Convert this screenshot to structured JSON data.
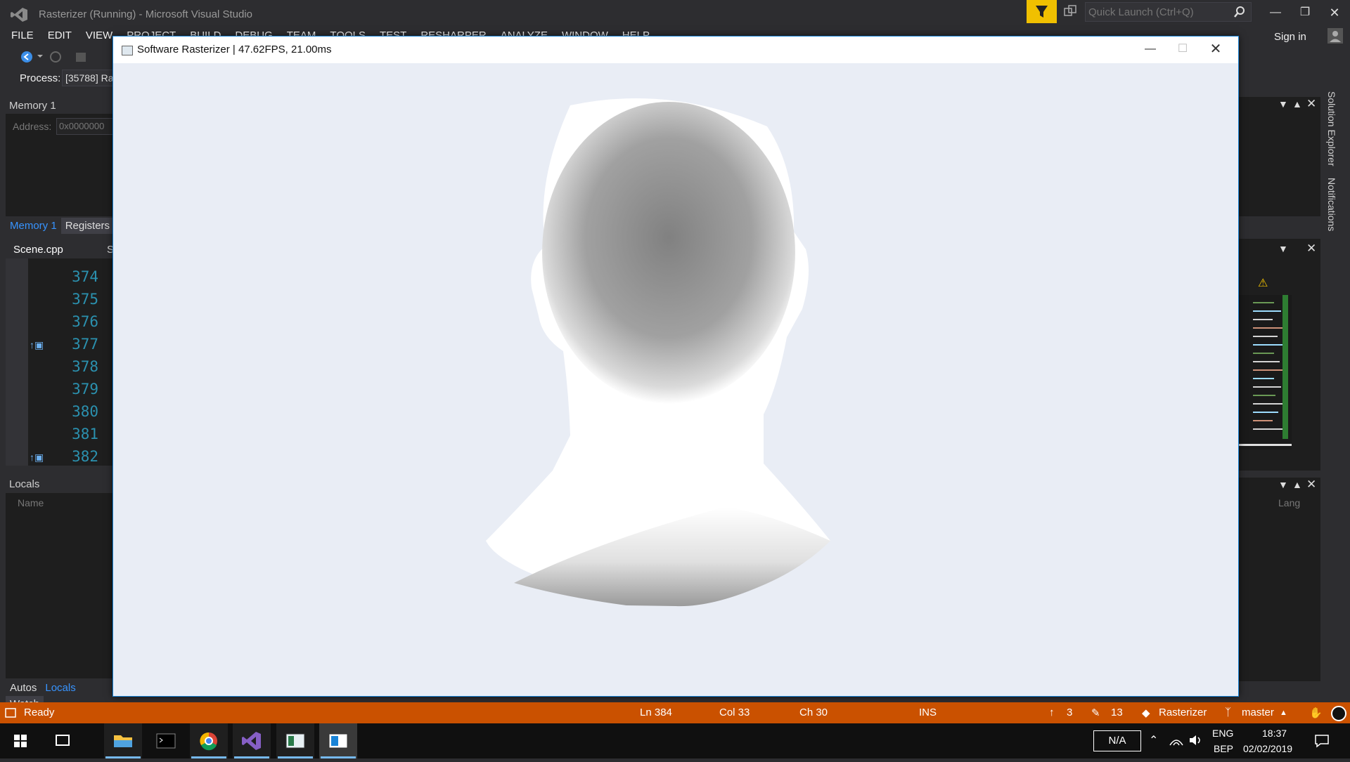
{
  "vs": {
    "title": "Rasterizer (Running) - Microsoft Visual Studio",
    "quick_launch_placeholder": "Quick Launch (Ctrl+Q)",
    "sign_in": "Sign in",
    "menu": [
      "FILE",
      "EDIT",
      "VIEW",
      "PROJECT",
      "BUILD",
      "DEBUG",
      "TEAM",
      "TOOLS",
      "TEST",
      "RESHARPER",
      "ANALYZE",
      "WINDOW",
      "HELP"
    ]
  },
  "process": {
    "label": "Process:",
    "value": "[35788] Ra"
  },
  "memory": {
    "title": "Memory 1",
    "address_label": "Address:",
    "address_value": "0x0000000"
  },
  "mem_tabs": {
    "memory": "Memory 1",
    "registers": "Registers"
  },
  "editor": {
    "tab": "Scene.cpp",
    "tab2": "Sc",
    "lines": [
      "374",
      "375",
      "376",
      "377",
      "378",
      "379",
      "380",
      "381",
      "382"
    ]
  },
  "locals": {
    "title": "Locals",
    "name_header": "Name",
    "lang_header": "Lang"
  },
  "bottom_tabs": {
    "autos": "Autos",
    "locals": "Locals",
    "watch": "Watch"
  },
  "side_tabs": {
    "solution_explorer": "Solution Explorer",
    "notifications": "Notifications"
  },
  "rasterizer": {
    "title": "Software Rasterizer | 47.62FPS, 21.00ms"
  },
  "status": {
    "ready": "Ready",
    "ln": "Ln 384",
    "col": "Col 33",
    "ch": "Ch 30",
    "ins": "INS",
    "up_count": "3",
    "edit_count": "13",
    "project": "Rasterizer",
    "branch": "master"
  },
  "tray": {
    "na": "N/A",
    "lang1": "ENG",
    "lang2": "BEP",
    "time": "18:37",
    "date": "02/02/2019"
  },
  "colors": {
    "accent": "#007acc",
    "status_bar": "#ca5100",
    "filter": "#f0c000"
  }
}
